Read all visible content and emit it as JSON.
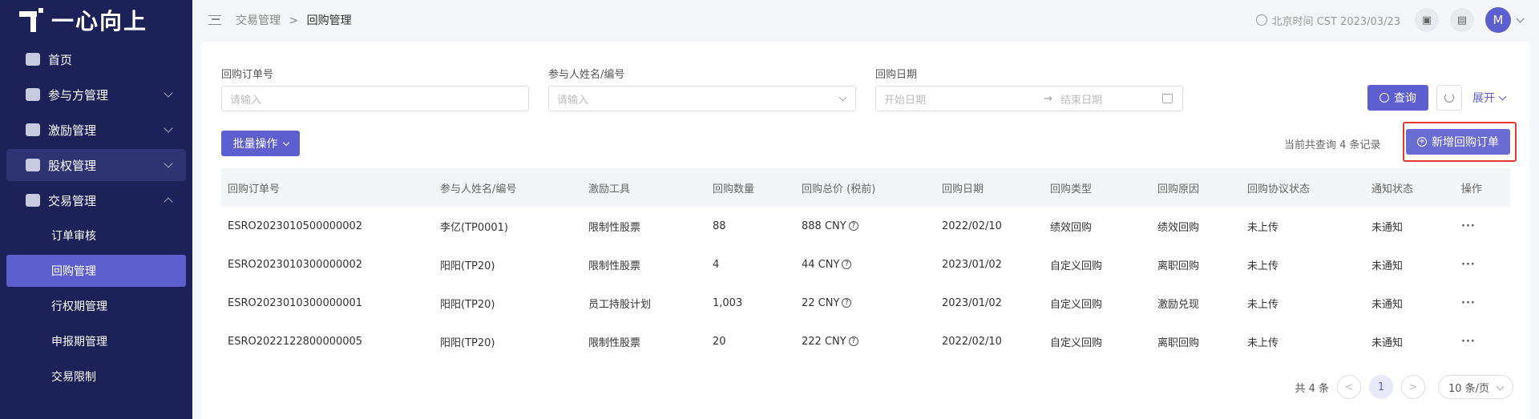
{
  "app": {
    "logo_text": "一心向上"
  },
  "sidebar": {
    "items": [
      {
        "label": "首页",
        "has_arrow": false
      },
      {
        "label": "参与方管理",
        "has_arrow": true
      },
      {
        "label": "激励管理",
        "has_arrow": true
      },
      {
        "label": "股权管理",
        "has_arrow": true
      },
      {
        "label": "交易管理",
        "has_arrow": true
      }
    ],
    "submenu": [
      {
        "label": "订单审核"
      },
      {
        "label": "回购管理"
      },
      {
        "label": "行权期管理"
      },
      {
        "label": "申报期管理"
      },
      {
        "label": "交易限制"
      }
    ]
  },
  "breadcrumb": {
    "parent": "交易管理",
    "sep": ">",
    "current": "回购管理"
  },
  "topbar": {
    "time": "北京时间 CST 2023/03/23",
    "avatar_letter": "M"
  },
  "filters": {
    "order_no": {
      "label": "回购订单号",
      "placeholder": "请输入"
    },
    "participant": {
      "label": "参与人姓名/编号",
      "placeholder": "请输入"
    },
    "date": {
      "label": "回购日期",
      "start_placeholder": "开始日期",
      "sep": "→",
      "end_placeholder": "结束日期"
    },
    "query_label": "查询",
    "expand_label": "展开"
  },
  "toolbar": {
    "batch_label": "批量操作",
    "record_count": "当前共查询 4 条记录",
    "add_label": "新增回购订单"
  },
  "table": {
    "headers": [
      "回购订单号",
      "参与人姓名/编号",
      "激励工具",
      "回购数量",
      "回购总价 (税前)",
      "回购日期",
      "回购类型",
      "回购原因",
      "回购协议状态",
      "通知状态",
      "操作"
    ],
    "rows": [
      {
        "order": "ESRO2023010500000002",
        "participant": "李亿(TP0001)",
        "tool": "限制性股票",
        "qty": "88",
        "price": "888 CNY",
        "date": "2022/02/10",
        "type": "绩效回购",
        "reason": "绩效回购",
        "agreement": "未上传",
        "notice": "未通知"
      },
      {
        "order": "ESRO2023010300000002",
        "participant": "阳阳(TP20)",
        "tool": "限制性股票",
        "qty": "4",
        "price": "44 CNY",
        "date": "2023/01/02",
        "type": "自定义回购",
        "reason": "离职回购",
        "agreement": "未上传",
        "notice": "未通知"
      },
      {
        "order": "ESRO2023010300000001",
        "participant": "阳阳(TP20)",
        "tool": "员工持股计划",
        "qty": "1,003",
        "price": "22 CNY",
        "date": "2023/01/02",
        "type": "自定义回购",
        "reason": "激励兑现",
        "agreement": "未上传",
        "notice": "未通知"
      },
      {
        "order": "ESRO2022122800000005",
        "participant": "阳阳(TP20)",
        "tool": "限制性股票",
        "qty": "20",
        "price": "222 CNY",
        "date": "2022/02/10",
        "type": "自定义回购",
        "reason": "离职回购",
        "agreement": "未上传",
        "notice": "未通知"
      }
    ],
    "more_glyph": "···",
    "help_glyph": "?"
  },
  "pagination": {
    "total": "共 4 条",
    "prev": "<",
    "page": "1",
    "next": ">",
    "page_size": "10 条/页"
  },
  "colors": {
    "sidebar_bg": "#1c2158",
    "accent": "#5d5fce",
    "highlight": "#e23b2e"
  }
}
